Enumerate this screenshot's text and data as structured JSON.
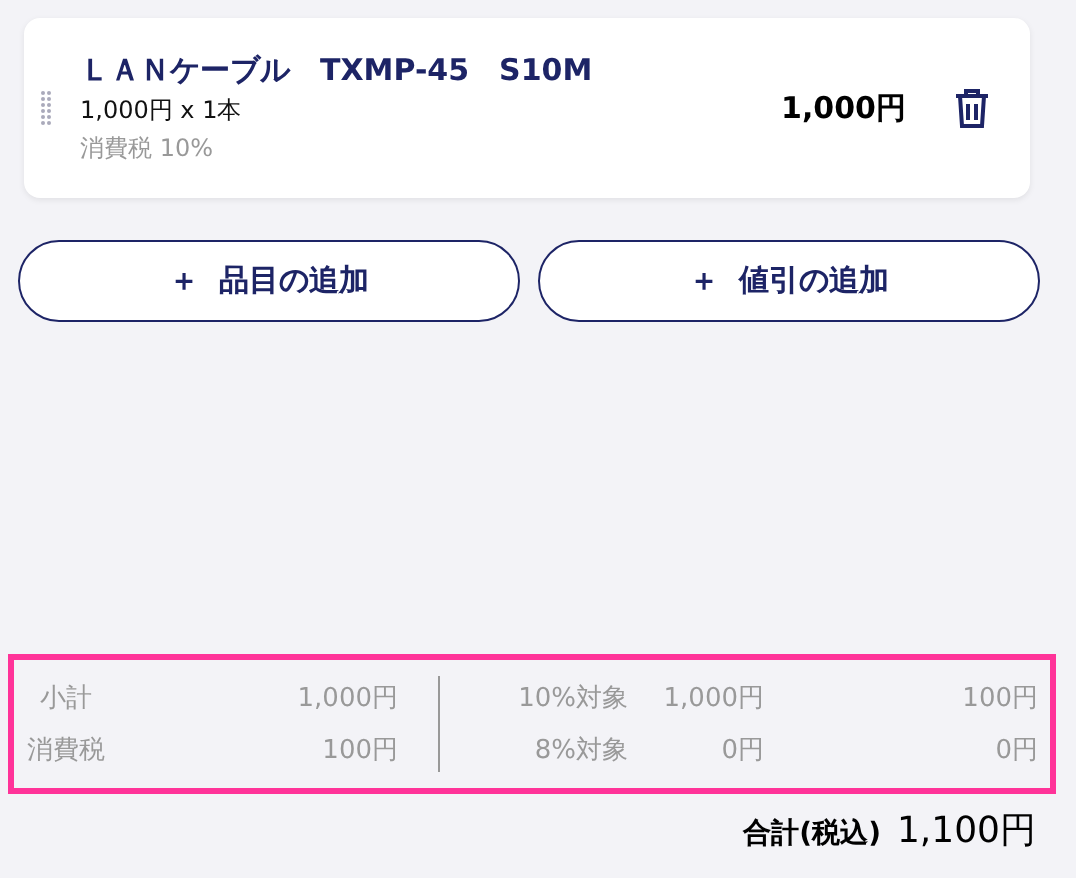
{
  "item": {
    "name": "ＬＡＮケーブル　TXMP-45　S10M",
    "quantity": "1,000円 x 1本",
    "tax": "消費税 10%",
    "amount": "1,000円"
  },
  "buttons": [
    {
      "icon": "＋",
      "label": "品目の追加"
    },
    {
      "icon": "＋",
      "label": "値引の追加"
    }
  ],
  "summary": {
    "left": [
      {
        "label": "小計",
        "value": "1,000円"
      },
      {
        "label": "消費税",
        "value": "100円"
      }
    ],
    "right": [
      {
        "label": "10%対象",
        "base": "1,000円",
        "tax": "100円"
      },
      {
        "label": "8%対象",
        "base": "0円",
        "tax": "0円"
      }
    ]
  },
  "total": {
    "label": "合計(税込)",
    "value": "1,100円"
  }
}
